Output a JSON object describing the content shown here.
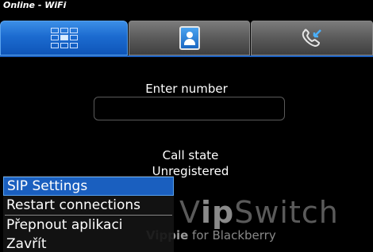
{
  "status": {
    "text": "Online - WiFi"
  },
  "tabs": [
    {
      "label": "",
      "icon": "dialpad-icon",
      "selected": true
    },
    {
      "label": "",
      "icon": "contacts-icon",
      "selected": false
    },
    {
      "label": "",
      "icon": "call-log-icon",
      "selected": false
    }
  ],
  "dialer": {
    "enter_label": "Enter number",
    "number_value": "",
    "number_placeholder": ""
  },
  "call_state": {
    "title": "Call state",
    "value": "Unregistered"
  },
  "logo": {
    "main_prefix": "V",
    "main_bold": "ip",
    "main_rest": "Switch",
    "sub_bold": "Vippie",
    "sub_rest": " for Blackberry"
  },
  "menu": {
    "items": [
      {
        "label": "SIP Settings",
        "selected": true
      },
      {
        "label": "Restart connections",
        "selected": false
      },
      {
        "label": "Přepnout aplikaci",
        "selected": false
      },
      {
        "label": "Zavřít",
        "selected": false
      }
    ]
  },
  "colors": {
    "accent": "#1a5fbf",
    "background": "#000000",
    "tab_inactive": "#5a5a5a"
  }
}
